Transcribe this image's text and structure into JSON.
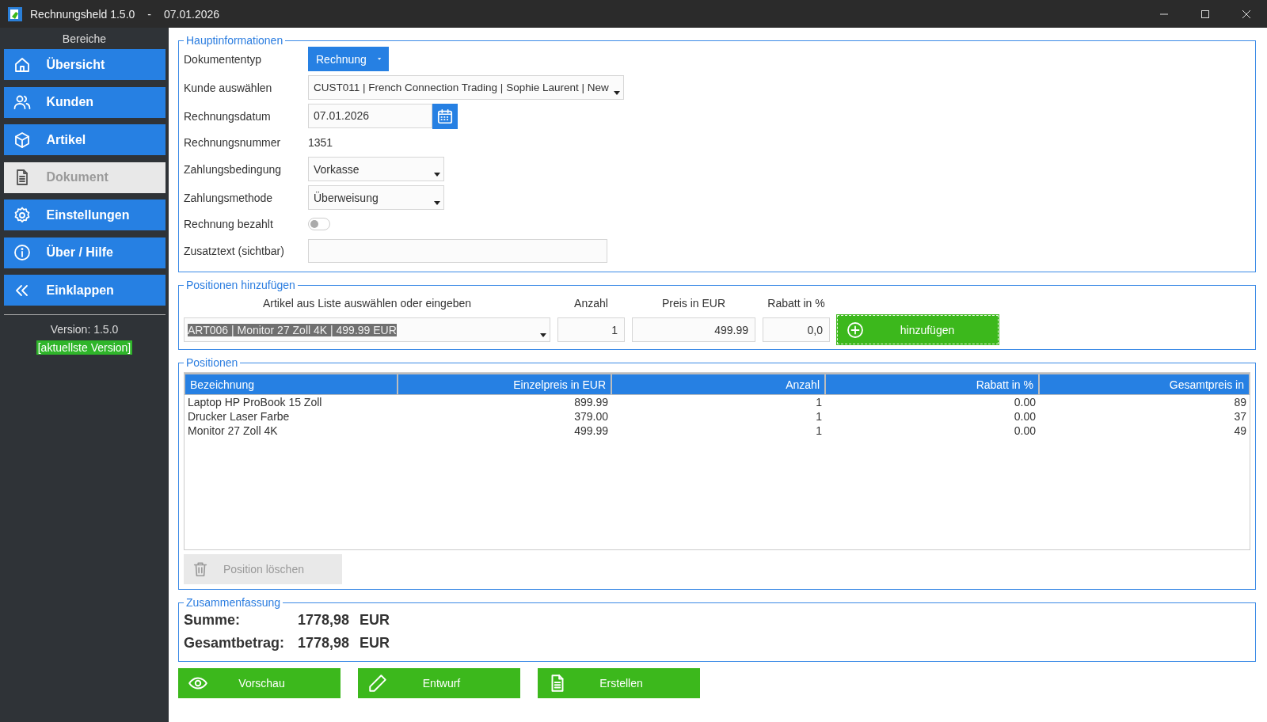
{
  "window": {
    "title": "Rechnungsheld 1.5.0",
    "separator": "-",
    "date": "07.01.2026"
  },
  "sidebar": {
    "heading": "Bereiche",
    "items": [
      {
        "label": "Übersicht",
        "disabled": false
      },
      {
        "label": "Kunden",
        "disabled": false
      },
      {
        "label": "Artikel",
        "disabled": false
      },
      {
        "label": "Dokument",
        "disabled": true
      },
      {
        "label": "Einstellungen",
        "disabled": false
      },
      {
        "label": "Über / Hilfe",
        "disabled": false
      },
      {
        "label": "Einklappen",
        "disabled": false
      }
    ],
    "version": "Version: 1.5.0",
    "version_badge": "[aktuellste Version]"
  },
  "main_info": {
    "legend": "Hauptinformationen",
    "rows": [
      {
        "kind": "dropdown-button",
        "label": "Dokumententyp",
        "value": "Rechnung"
      },
      {
        "kind": "combo",
        "label": "Kunde auswählen",
        "value": "CUST011 | French Connection Trading | Sophie Laurent | New"
      },
      {
        "kind": "date",
        "label": "Rechnungsdatum",
        "value": "07.01.2026"
      },
      {
        "kind": "text",
        "label": "Rechnungsnummer",
        "value": "1351"
      },
      {
        "kind": "combo",
        "label": "Zahlungsbedingung",
        "value": "Vorkasse"
      },
      {
        "kind": "combo",
        "label": "Zahlungsmethode",
        "value": "Überweisung"
      },
      {
        "kind": "toggle",
        "label": "Rechnung bezahlt",
        "on": false
      },
      {
        "kind": "input",
        "label": "Zusatztext (sichtbar)"
      }
    ]
  },
  "add_positions": {
    "legend": "Positionen hinzufügen",
    "headers": [
      "Artikel aus Liste auswählen oder eingeben",
      "Anzahl",
      "Preis in EUR",
      "Rabatt in %"
    ],
    "article": {
      "value": "ART006 | Monitor 27 Zoll 4K | 499.99 EUR",
      "highlighted": true
    },
    "quantity": "1",
    "price": "499.99",
    "discount": "0,0",
    "add_button": "hinzufügen"
  },
  "positions": {
    "legend": "Positionen",
    "columns": [
      "Bezeichnung",
      "Einzelpreis in EUR",
      "Anzahl",
      "Rabatt in %",
      "Gesamtpreis in"
    ],
    "rows": [
      [
        "Laptop HP ProBook 15 Zoll",
        "899.99",
        "1",
        "0.00",
        "89"
      ],
      [
        "Drucker Laser Farbe",
        "379.00",
        "1",
        "0.00",
        "37"
      ],
      [
        "Monitor 27 Zoll 4K",
        "499.99",
        "1",
        "0.00",
        "49"
      ]
    ],
    "delete_button": {
      "label": "Position löschen",
      "disabled": true
    }
  },
  "summary": {
    "legend": "Zusammenfassung",
    "rows": [
      {
        "label": "Summe:",
        "amount": "1778,98",
        "currency": "EUR"
      },
      {
        "label": "Gesamtbetrag:",
        "amount": "1778,98",
        "currency": "EUR"
      }
    ]
  },
  "actions": [
    {
      "label": "Vorschau"
    },
    {
      "label": "Entwurf"
    },
    {
      "label": "Erstellen"
    }
  ]
}
